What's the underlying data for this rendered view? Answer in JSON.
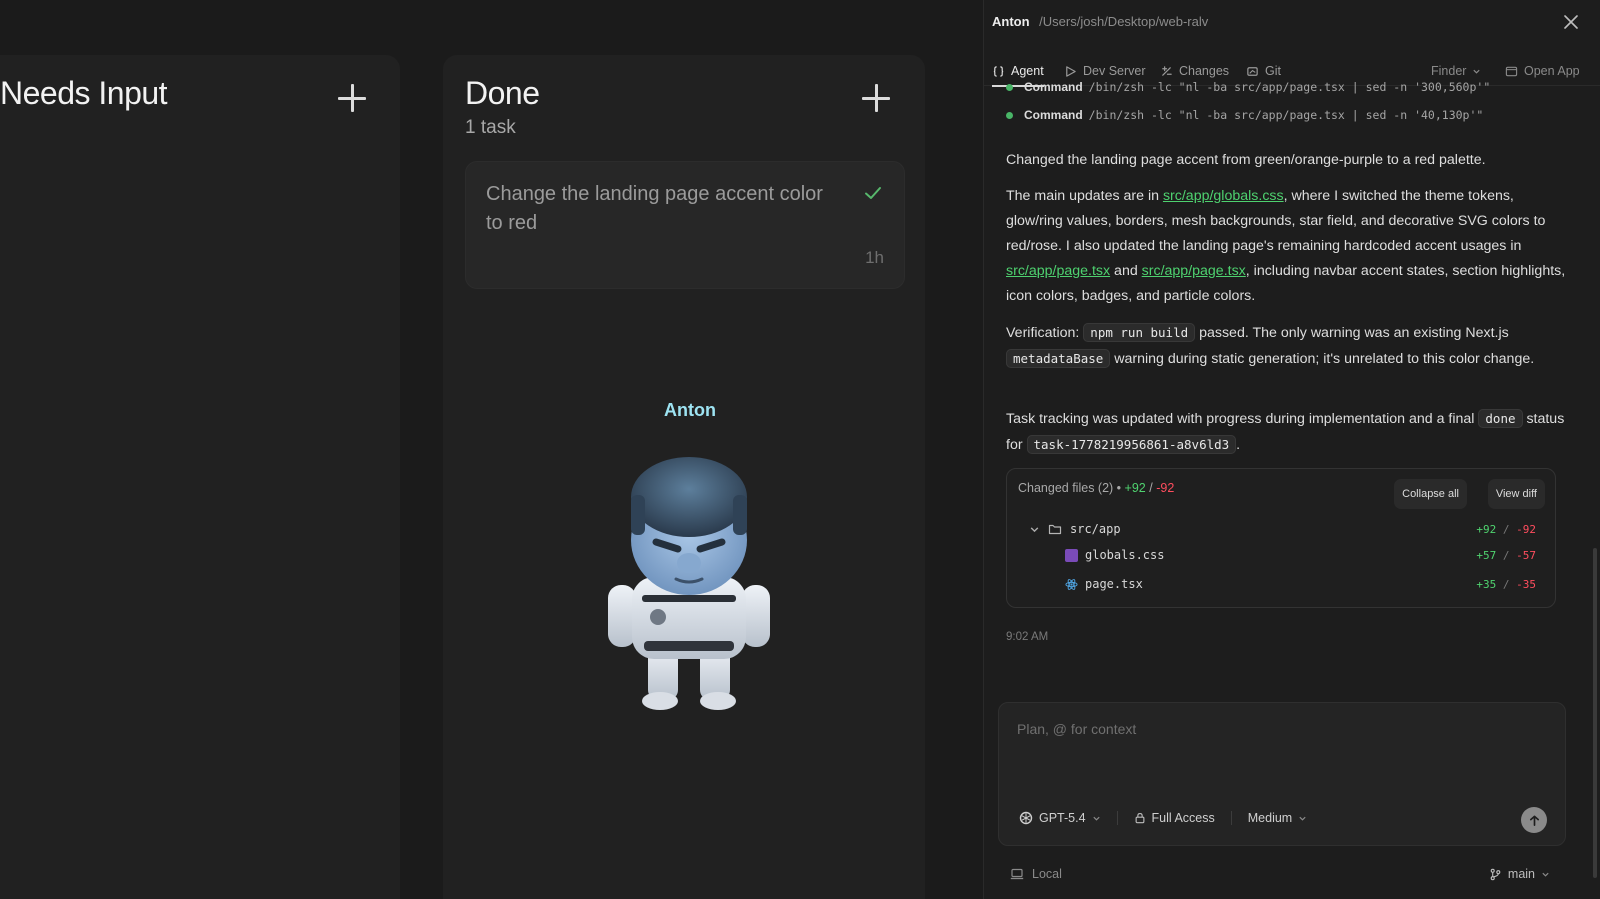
{
  "board": {
    "columns": [
      {
        "title": "Needs Input"
      },
      {
        "title": "Done",
        "count": "1 task"
      }
    ],
    "task": {
      "title": "Change the landing page accent color to red",
      "age": "1h"
    },
    "agent": {
      "name": "Anton"
    }
  },
  "panel": {
    "header": {
      "agent": "Anton",
      "path": "/Users/josh/Desktop/web-ralv"
    },
    "tabs": [
      {
        "label": "Agent",
        "icon": "braces-icon"
      },
      {
        "label": "Dev Server",
        "icon": "play-icon"
      },
      {
        "label": "Changes",
        "icon": "diff-icon"
      },
      {
        "label": "Git",
        "icon": "git-icon"
      }
    ],
    "finder_label": "Finder",
    "open_app_label": "Open App",
    "commands": [
      {
        "label": "Command",
        "text": "/bin/zsh -lc \"nl -ba src/app/page.tsx | sed -n '300,560p'\""
      },
      {
        "label": "Command",
        "text": "/bin/zsh -lc \"nl -ba src/app/page.tsx | sed -n '40,130p'\""
      }
    ],
    "summary": "Changed the landing page accent from green/orange-purple to a red palette.",
    "para2": {
      "t1": "The main updates are in ",
      "link1": "src/app/globals.css",
      "t2": ", where I switched the theme tokens, glow/ring values, borders, mesh backgrounds, star field, and decorative SVG colors to red/rose. I also updated the landing page's remaining hardcoded accent usages in ",
      "link2": "src/app/page.tsx",
      "t3": " and ",
      "link3": "src/app/page.tsx",
      "t4": ", including navbar accent states, section highlights, icon colors, badges, and particle colors."
    },
    "para3": {
      "t1": "Verification: ",
      "code1": "npm run build",
      "t2": " passed. The only warning was an existing Next.js ",
      "code2": "metadataBase",
      "t3": " warning during static generation; it's unrelated to this color change."
    },
    "para4": {
      "t1": "Task tracking was updated with progress during implementation and a final ",
      "code1": "done",
      "t2": " status for ",
      "code2": "task-1778219956861-a8v6ld3",
      "t3": "."
    },
    "changed_files": {
      "label": "Changed files (2) •",
      "added": "+92",
      "sep": "/",
      "removed": "-92",
      "collapse_all": "Collapse all",
      "view_diff": "View diff",
      "folder": {
        "name": "src/app",
        "added": "+92",
        "removed": "-92"
      },
      "files": [
        {
          "name": "globals.css",
          "added": "+57",
          "removed": "-57",
          "icon": "css-file-icon"
        },
        {
          "name": "page.tsx",
          "added": "+35",
          "removed": "-35",
          "icon": "react-file-icon"
        }
      ]
    },
    "timestamp": "9:02 AM",
    "composer": {
      "placeholder": "Plan, @ for context",
      "model": "GPT-5.4",
      "access": "Full Access",
      "effort": "Medium"
    },
    "footer": {
      "location": "Local",
      "branch": "main"
    }
  },
  "colors": {
    "accent_green": "#4ed16f",
    "removed_red": "#ff4d5e",
    "agent_cyan": "#9de3f2"
  }
}
